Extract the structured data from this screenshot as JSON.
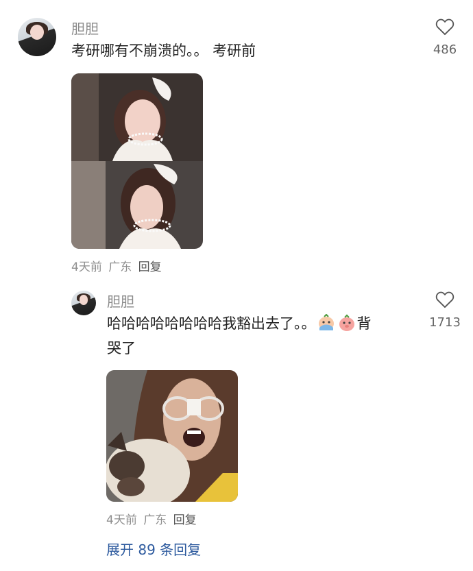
{
  "comment": {
    "username": "胆胆",
    "text": "考研哪有不崩溃的。。 考研前",
    "likes": "486",
    "time": "4天前",
    "location": "广东",
    "reply_label": "回复"
  },
  "reply": {
    "username": "胆胆",
    "text_line1": "哈哈哈哈哈哈哈哈我豁出去了。。",
    "text_after_emoji": "背",
    "text_line2": "哭了",
    "emojis": [
      "crying-face-emoji",
      "pig-face-emoji"
    ],
    "likes": "1713",
    "time": "4天前",
    "location": "广东",
    "reply_label": "回复"
  },
  "expand_label": "展开 89 条回复",
  "colors": {
    "link": "#2d5a9e",
    "meta": "#8f8f8f",
    "name": "#8a8a8a"
  }
}
